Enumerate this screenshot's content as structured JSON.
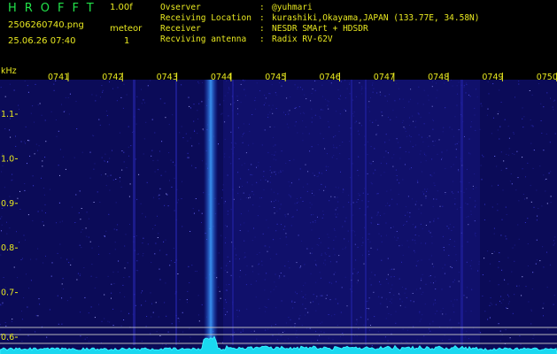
{
  "header": {
    "app_title": "HROFFT",
    "version": "1.00f",
    "file_name": "2506260740.png",
    "datetime": "25.06.26 07:40",
    "mode": "meteor",
    "count": "1",
    "info": [
      {
        "key": "Ovserver",
        "value": "@yuhmari"
      },
      {
        "key": "Receiving Location",
        "value": "kurashiki,Okayama,JAPAN (133.77E, 34.58N)"
      },
      {
        "key": "Receiver",
        "value": "NESDR SMArt + HDSDR"
      },
      {
        "key": "Recviving antenna",
        "value": "Radix RV-62V"
      }
    ]
  },
  "spectrogram": {
    "freq_unit": "kHz",
    "freq_labels": [
      "1.1",
      "1.0",
      "0.9",
      "0.8",
      "0.7",
      "0.6"
    ],
    "time_labels": [
      "0741",
      "0742",
      "0743",
      "0744",
      "0745",
      "0746",
      "0747",
      "0748",
      "0749",
      "0750"
    ],
    "colors": {
      "background": "#0b0b58",
      "grid": "#ffff80",
      "noise_floor": "#36f0ff",
      "echo": "#3da0ff"
    }
  }
}
